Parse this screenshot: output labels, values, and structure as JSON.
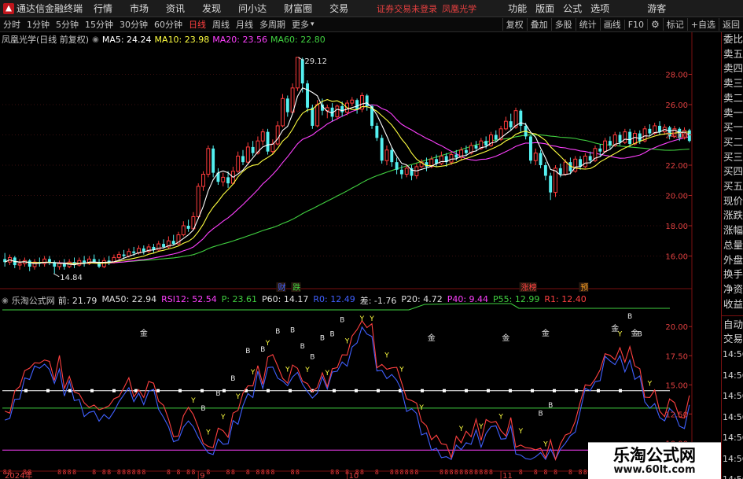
{
  "titlebar": {
    "app_name": "通达信金融终端",
    "menus": [
      "行情",
      "市场",
      "资讯",
      "发现",
      "问小达",
      "财富圈",
      "交易"
    ],
    "warning": "证券交易未登录",
    "stock": "凤凰光学",
    "right_menus": [
      "功能",
      "版面",
      "公式",
      "选项"
    ],
    "guest": "游客"
  },
  "toolbar": {
    "periods": [
      "分时",
      "1分钟",
      "5分钟",
      "15分钟",
      "30分钟",
      "60分钟",
      "日线",
      "周线",
      "月线",
      "多周期",
      "更多"
    ],
    "active_period": "日线",
    "tools": [
      "复权",
      "叠加",
      "多股",
      "统计",
      "画线",
      "F10",
      "标记",
      "+自选",
      "返回"
    ]
  },
  "price_header": {
    "title": "凤凰光学(日线 前复权)",
    "ma5": "MA5: 24.24",
    "ma10": "MA10: 23.98",
    "ma20": "MA20: 23.56",
    "ma60": "MA60: 22.80"
  },
  "indicator_header": {
    "title": "乐淘公式网",
    "items": [
      {
        "text": "前: 21.79",
        "color": "#e0e0e0"
      },
      {
        "text": "MA50: 22.94",
        "color": "#e0e0e0"
      },
      {
        "text": "RSI12: 52.54",
        "color": "#ff40ff"
      },
      {
        "text": "P: 23.61",
        "color": "#40d040"
      },
      {
        "text": "P60: 14.17",
        "color": "#e0e0e0"
      },
      {
        "text": "R0: 12.49",
        "color": "#4060ff"
      },
      {
        "text": "差: -1.76",
        "color": "#e0e0e0"
      },
      {
        "text": "P20: 4.72",
        "color": "#e0e0e0"
      },
      {
        "text": "P40: 9.44",
        "color": "#ff40ff"
      },
      {
        "text": "P55: 12.99",
        "color": "#40d040"
      },
      {
        "text": "R1: 12.40",
        "color": "#ff4040"
      }
    ]
  },
  "right_tabs": {
    "order_book": [
      "委比",
      "卖五",
      "卖四",
      "卖三",
      "卖二",
      "卖一",
      "买一",
      "买二",
      "买三",
      "买四",
      "买五",
      "现价",
      "涨跌",
      "涨幅",
      "总量",
      "外盘",
      "换手",
      "净资",
      "收益"
    ],
    "bottom": [
      "自动",
      "交易"
    ],
    "axis_values": [
      "14:56",
      "14:56",
      "14:56",
      "14:56",
      "14:56",
      "14:56",
      "14:56"
    ]
  },
  "chart_data": [
    {
      "type": "candlestick",
      "title": "凤凰光学(日线 前复权)",
      "y_ticks": [
        16.0,
        18.0,
        20.0,
        22.0,
        24.0,
        26.0,
        28.0
      ],
      "ylim": [
        14.0,
        30.0
      ],
      "high_label": "29.12",
      "low_label": "14.84",
      "x_tick_labels": [
        "2024年",
        "9",
        "10",
        "11",
        "12",
        "1"
      ],
      "annotations": [
        "财",
        "跌",
        "涨榜",
        "预"
      ],
      "series": [
        "MA5",
        "MA10",
        "MA20",
        "MA60"
      ],
      "colors": {
        "up": "#ff3c3c",
        "down": "#54f0f0",
        "ma5": "#ffffff",
        "ma10": "#ffff40",
        "ma20": "#ff40ff",
        "ma60": "#40d040"
      },
      "candles": [
        [
          15.8,
          15.6,
          16.2,
          15.3
        ],
        [
          15.6,
          15.9,
          16.1,
          15.4
        ],
        [
          15.9,
          15.4,
          16.0,
          15.2
        ],
        [
          15.4,
          15.5,
          15.8,
          15.1
        ],
        [
          15.5,
          15.7,
          15.9,
          15.3
        ],
        [
          15.7,
          15.3,
          15.8,
          15.0
        ],
        [
          15.3,
          15.6,
          15.8,
          15.1
        ],
        [
          15.6,
          15.5,
          15.9,
          15.3
        ],
        [
          15.5,
          15.8,
          16.0,
          15.3
        ],
        [
          15.8,
          15.6,
          16.0,
          15.4
        ],
        [
          15.6,
          15.3,
          15.7,
          14.84
        ],
        [
          15.3,
          15.5,
          15.7,
          15.1
        ],
        [
          15.5,
          15.3,
          15.8,
          15.1
        ],
        [
          15.3,
          15.6,
          15.8,
          15.2
        ],
        [
          15.6,
          15.4,
          15.9,
          15.2
        ],
        [
          15.4,
          15.7,
          15.9,
          15.3
        ],
        [
          15.7,
          15.5,
          16.0,
          15.3
        ],
        [
          15.5,
          15.8,
          16.0,
          15.4
        ],
        [
          15.8,
          15.6,
          16.1,
          15.5
        ],
        [
          15.6,
          15.3,
          15.8,
          15.2
        ],
        [
          15.3,
          15.7,
          15.9,
          15.2
        ],
        [
          15.7,
          15.6,
          16.0,
          15.4
        ],
        [
          15.6,
          15.9,
          16.1,
          15.5
        ],
        [
          15.9,
          16.1,
          16.3,
          15.7
        ],
        [
          16.1,
          16.0,
          16.4,
          15.8
        ],
        [
          16.0,
          16.3,
          16.5,
          15.9
        ],
        [
          16.3,
          16.2,
          16.6,
          16.0
        ],
        [
          16.2,
          16.5,
          16.7,
          16.1
        ],
        [
          16.5,
          16.3,
          16.7,
          16.1
        ],
        [
          16.3,
          16.6,
          16.8,
          16.2
        ],
        [
          16.6,
          16.4,
          16.8,
          16.2
        ],
        [
          16.4,
          16.8,
          17.0,
          16.3
        ],
        [
          16.8,
          16.6,
          17.1,
          16.5
        ],
        [
          16.6,
          17.0,
          17.3,
          16.5
        ],
        [
          17.0,
          16.8,
          17.4,
          16.7
        ],
        [
          16.8,
          17.4,
          17.6,
          16.7
        ],
        [
          17.4,
          18.0,
          18.3,
          17.3
        ],
        [
          18.0,
          17.8,
          18.4,
          17.6
        ],
        [
          17.8,
          18.6,
          18.9,
          17.7
        ],
        [
          18.6,
          20.6,
          20.8,
          18.5
        ],
        [
          20.6,
          21.4,
          21.6,
          20.3
        ],
        [
          21.4,
          23.1,
          23.3,
          21.2
        ],
        [
          23.1,
          21.5,
          23.3,
          21.2
        ],
        [
          21.5,
          20.9,
          21.8,
          20.7
        ],
        [
          20.9,
          21.2,
          21.5,
          20.6
        ],
        [
          21.2,
          20.8,
          21.6,
          20.5
        ],
        [
          20.8,
          21.6,
          21.9,
          20.7
        ],
        [
          21.6,
          22.6,
          22.9,
          21.5
        ],
        [
          22.6,
          22.2,
          23.0,
          22.0
        ],
        [
          22.2,
          23.2,
          23.5,
          22.1
        ],
        [
          23.2,
          22.8,
          23.6,
          22.6
        ],
        [
          22.8,
          23.6,
          23.9,
          22.7
        ],
        [
          23.6,
          24.2,
          24.4,
          23.3
        ],
        [
          24.2,
          22.9,
          24.4,
          22.7
        ],
        [
          22.9,
          23.4,
          23.7,
          22.7
        ],
        [
          23.4,
          24.6,
          24.9,
          23.3
        ],
        [
          24.6,
          26.4,
          26.7,
          24.5
        ],
        [
          26.4,
          25.5,
          26.6,
          25.2
        ],
        [
          25.5,
          27.1,
          27.4,
          25.4
        ],
        [
          27.1,
          29.12,
          29.12,
          26.9
        ],
        [
          29.0,
          27.4,
          29.1,
          26.8
        ],
        [
          27.4,
          25.8,
          27.6,
          25.5
        ],
        [
          25.8,
          24.6,
          26.0,
          24.4
        ],
        [
          24.6,
          26.0,
          26.3,
          24.5
        ],
        [
          26.0,
          25.6,
          26.4,
          25.3
        ],
        [
          25.6,
          25.8,
          26.0,
          25.1
        ],
        [
          25.8,
          25.2,
          26.1,
          24.9
        ],
        [
          25.2,
          25.9,
          26.0,
          25.0
        ],
        [
          25.9,
          25.5,
          26.2,
          25.2
        ],
        [
          25.5,
          26.1,
          26.3,
          25.3
        ],
        [
          26.1,
          26.3,
          26.5,
          25.9
        ],
        [
          26.3,
          25.7,
          26.4,
          25.4
        ],
        [
          25.7,
          26.6,
          26.8,
          25.5
        ],
        [
          26.6,
          25.9,
          26.7,
          25.6
        ],
        [
          25.9,
          24.6,
          26.0,
          24.4
        ],
        [
          24.6,
          23.8,
          24.8,
          23.6
        ],
        [
          23.8,
          22.3,
          24.0,
          22.1
        ],
        [
          22.3,
          23.0,
          23.3,
          22.0
        ],
        [
          23.0,
          22.2,
          23.2,
          21.9
        ],
        [
          22.2,
          21.7,
          22.5,
          21.4
        ],
        [
          21.7,
          21.4,
          22.0,
          21.1
        ],
        [
          21.4,
          21.8,
          22.0,
          21.2
        ],
        [
          21.8,
          21.3,
          22.0,
          21.0
        ],
        [
          21.3,
          21.9,
          22.1,
          21.1
        ],
        [
          21.9,
          22.2,
          22.4,
          21.8
        ],
        [
          22.2,
          21.9,
          22.5,
          21.6
        ],
        [
          21.9,
          22.4,
          22.6,
          21.8
        ],
        [
          22.4,
          22.1,
          22.7,
          21.9
        ],
        [
          22.1,
          22.6,
          22.9,
          22.0
        ],
        [
          22.6,
          22.2,
          22.8,
          21.9
        ],
        [
          22.2,
          22.7,
          22.9,
          22.0
        ],
        [
          22.7,
          22.5,
          23.0,
          22.3
        ],
        [
          22.5,
          23.0,
          23.2,
          22.3
        ],
        [
          23.0,
          22.8,
          23.3,
          22.6
        ],
        [
          22.8,
          23.3,
          23.5,
          22.7
        ],
        [
          23.3,
          23.1,
          23.6,
          22.9
        ],
        [
          23.1,
          23.6,
          23.8,
          23.0
        ],
        [
          23.6,
          23.3,
          23.9,
          23.1
        ],
        [
          23.3,
          24.0,
          24.2,
          23.2
        ],
        [
          24.0,
          23.7,
          24.3,
          23.5
        ],
        [
          23.7,
          24.4,
          24.6,
          23.6
        ],
        [
          24.4,
          24.9,
          25.2,
          24.3
        ],
        [
          24.9,
          24.5,
          25.4,
          24.3
        ],
        [
          24.5,
          25.6,
          25.8,
          24.4
        ],
        [
          25.6,
          24.6,
          25.7,
          24.2
        ],
        [
          24.6,
          23.9,
          24.8,
          23.7
        ],
        [
          23.9,
          22.3,
          24.0,
          22.1
        ],
        [
          22.3,
          22.8,
          23.1,
          22.0
        ],
        [
          22.8,
          22.0,
          23.0,
          21.8
        ],
        [
          22.0,
          21.3,
          22.2,
          21.0
        ],
        [
          21.3,
          20.2,
          21.5,
          19.7
        ],
        [
          20.2,
          21.8,
          22.0,
          19.9
        ],
        [
          21.8,
          21.4,
          22.1,
          21.2
        ],
        [
          21.4,
          22.2,
          22.4,
          21.3
        ],
        [
          22.2,
          21.6,
          22.5,
          21.4
        ],
        [
          21.6,
          22.4,
          22.6,
          21.5
        ],
        [
          22.4,
          21.9,
          22.6,
          21.7
        ],
        [
          21.9,
          22.6,
          22.8,
          21.8
        ],
        [
          22.6,
          22.3,
          22.9,
          22.1
        ],
        [
          22.3,
          23.1,
          23.3,
          22.2
        ],
        [
          23.1,
          22.9,
          23.4,
          22.6
        ],
        [
          22.9,
          23.6,
          23.8,
          22.8
        ],
        [
          23.6,
          23.3,
          23.9,
          23.1
        ],
        [
          23.3,
          24.0,
          24.2,
          23.2
        ],
        [
          24.0,
          23.5,
          24.2,
          23.3
        ],
        [
          23.5,
          24.2,
          24.4,
          23.4
        ],
        [
          24.2,
          23.4,
          24.4,
          23.2
        ],
        [
          23.4,
          24.1,
          24.3,
          23.3
        ],
        [
          24.1,
          23.6,
          24.3,
          23.4
        ],
        [
          23.6,
          24.4,
          24.6,
          23.5
        ],
        [
          24.4,
          24.1,
          24.7,
          23.9
        ],
        [
          24.1,
          24.6,
          24.8,
          24.0
        ],
        [
          24.6,
          24.2,
          24.9,
          24.0
        ],
        [
          24.2,
          24.5,
          24.7,
          24.0
        ],
        [
          24.5,
          23.9,
          24.6,
          23.7
        ],
        [
          23.9,
          24.4,
          24.6,
          23.8
        ],
        [
          24.4,
          23.8,
          24.5,
          23.6
        ],
        [
          23.8,
          24.3,
          24.5,
          23.7
        ],
        [
          24.3,
          23.6,
          24.4,
          23.5
        ]
      ]
    },
    {
      "type": "line",
      "title": "乐淘公式网",
      "y_ticks": [
        10.0,
        12.5,
        15.0,
        17.5,
        20.0
      ],
      "ylim": [
        8.0,
        21.5
      ],
      "series": [
        {
          "name": "P55",
          "color": "#40d040",
          "values": [
            13.0,
            13.0,
            13.0,
            13.0,
            13.0,
            13.0,
            13.0,
            13.0,
            13.0,
            13.0
          ]
        },
        {
          "name": "P40",
          "color": "#ff40ff",
          "values": [
            9.4,
            9.4,
            9.4,
            9.4,
            9.4,
            9.4,
            9.4,
            9.4,
            9.4,
            9.4
          ]
        },
        {
          "name": "R0",
          "color": "#4060ff",
          "values": [
            12.49
          ]
        },
        {
          "name": "R1",
          "color": "#ff4040",
          "values": [
            12.4
          ]
        }
      ],
      "markers": [
        "B",
        "Y",
        "金"
      ]
    }
  ]
}
